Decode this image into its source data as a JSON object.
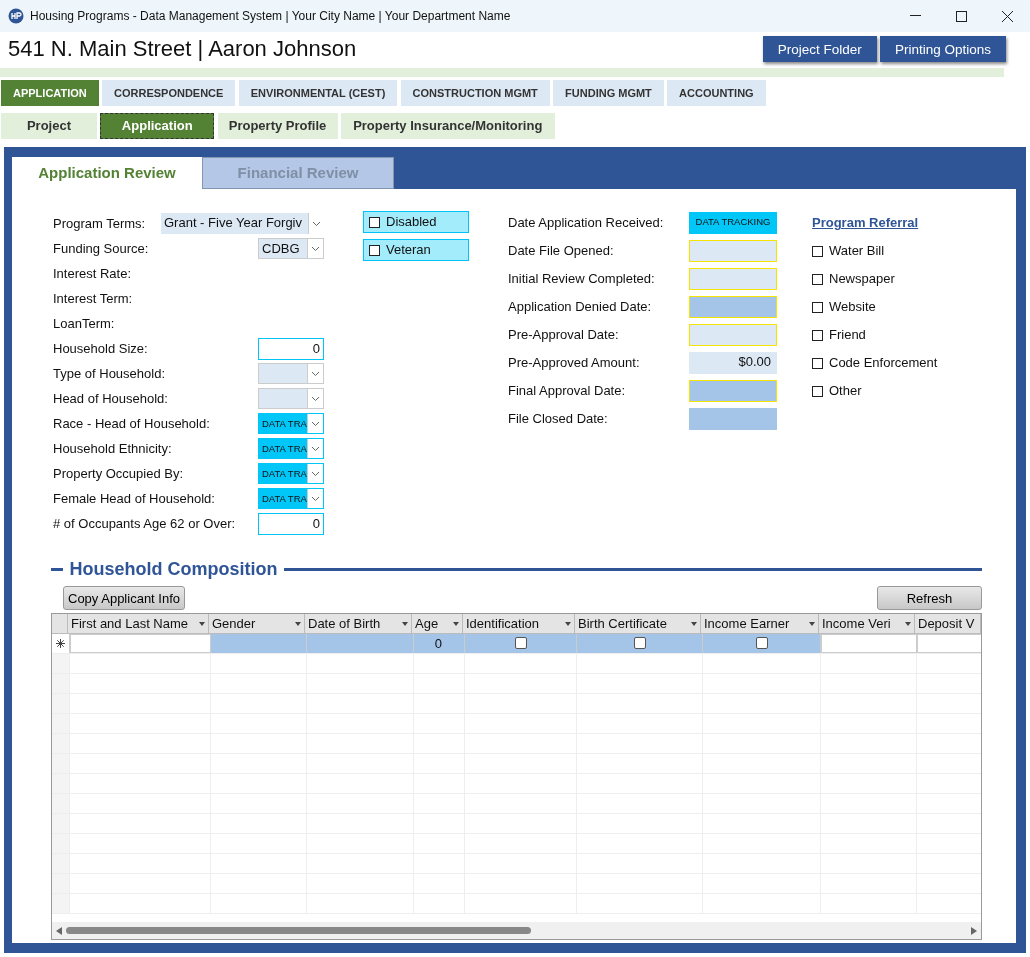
{
  "window": {
    "title": "Housing Programs - Data Management System | Your City Name | Your Department Name"
  },
  "header": {
    "title": "541 N. Main Street | Aaron Johnson",
    "buttons": [
      "Project Folder",
      "Printing Options"
    ]
  },
  "main_tabs": [
    {
      "label": "APPLICATION",
      "selected": true
    },
    {
      "label": "CORRESPONDENCE",
      "selected": false
    },
    {
      "label": "ENVIRONMENTAL (CEST)",
      "selected": false
    },
    {
      "label": "CONSTRUCTION MGMT",
      "selected": false
    },
    {
      "label": "FUNDING MGMT",
      "selected": false
    },
    {
      "label": "ACCOUNTING",
      "selected": false
    }
  ],
  "sub_tabs": [
    {
      "label": "Project",
      "selected": false
    },
    {
      "label": "Application",
      "selected": true
    },
    {
      "label": "Property Profile",
      "selected": false
    },
    {
      "label": "Property Insurance/Monitoring",
      "selected": false
    }
  ],
  "review_tabs": [
    {
      "label": "Application Review",
      "selected": true
    },
    {
      "label": "Financial Review",
      "selected": false
    }
  ],
  "left_fields": [
    {
      "label": "Program Terms:",
      "kind": "wide-combo",
      "value": "Grant - Five Year Forgiv"
    },
    {
      "label": "Funding Source:",
      "kind": "combo",
      "value": "CDBG"
    },
    {
      "label": "Interest Rate:",
      "kind": "label"
    },
    {
      "label": "Interest Term:",
      "kind": "label"
    },
    {
      "label": "LoanTerm:",
      "kind": "label"
    },
    {
      "label": "Household Size:",
      "kind": "number",
      "value": "0"
    },
    {
      "label": "Type of Household:",
      "kind": "combo"
    },
    {
      "label": "Head of Household:",
      "kind": "combo"
    },
    {
      "label": "Race - Head of Household:",
      "kind": "tracking-combo",
      "value": "DATA TRA"
    },
    {
      "label": "Household Ethnicity:",
      "kind": "tracking-combo",
      "value": "DATA TRA"
    },
    {
      "label": "Property Occupied By:",
      "kind": "tracking-combo",
      "value": "DATA TRA"
    },
    {
      "label": "Female Head of Household:",
      "kind": "tracking-combo",
      "value": "DATA TRA"
    },
    {
      "label": "# of Occupants Age 62 or Over:",
      "kind": "number",
      "value": "0"
    }
  ],
  "flags": [
    {
      "label": "Disabled",
      "checked": false
    },
    {
      "label": "Veteran",
      "checked": false
    }
  ],
  "dates": [
    {
      "label": "Date Application Received:",
      "kind": "tracking",
      "value": "DATA TRACKING"
    },
    {
      "label": "Date File Opened:",
      "kind": "open"
    },
    {
      "label": "Initial Review Completed:",
      "kind": "open"
    },
    {
      "label": "Application Denied Date:",
      "kind": "locked-edit"
    },
    {
      "label": "Pre-Approval Date:",
      "kind": "open"
    },
    {
      "label": "Pre-Approved Amount:",
      "kind": "amount",
      "value": "$0.00"
    },
    {
      "label": "Final Approval Date:",
      "kind": "locked-edit"
    },
    {
      "label": "File Closed Date:",
      "kind": "locked"
    }
  ],
  "referral": {
    "title": "Program Referral",
    "items": [
      {
        "label": "Water Bill",
        "checked": false
      },
      {
        "label": "Newspaper",
        "checked": false
      },
      {
        "label": "Website",
        "checked": false
      },
      {
        "label": "Friend",
        "checked": false
      },
      {
        "label": "Code Enforcement",
        "checked": false
      },
      {
        "label": "Other",
        "checked": false
      }
    ]
  },
  "household": {
    "title": "Household Composition",
    "buttons": [
      "Copy Applicant Info",
      "Refresh"
    ],
    "columns": [
      "First and Last Name",
      "Gender",
      "Date of Birth",
      "Age",
      "Identification",
      "Birth Certificate",
      "Income Earner",
      "Income Veri",
      "Deposit V"
    ],
    "new_row": [
      {
        "kind": "blank"
      },
      {
        "kind": "blank-shaded"
      },
      {
        "kind": "blank-shaded"
      },
      {
        "kind": "number",
        "value": "0"
      },
      {
        "kind": "check",
        "checked": false
      },
      {
        "kind": "check",
        "checked": false
      },
      {
        "kind": "check",
        "checked": false
      },
      {
        "kind": "blank"
      },
      {
        "kind": "blank"
      }
    ]
  }
}
